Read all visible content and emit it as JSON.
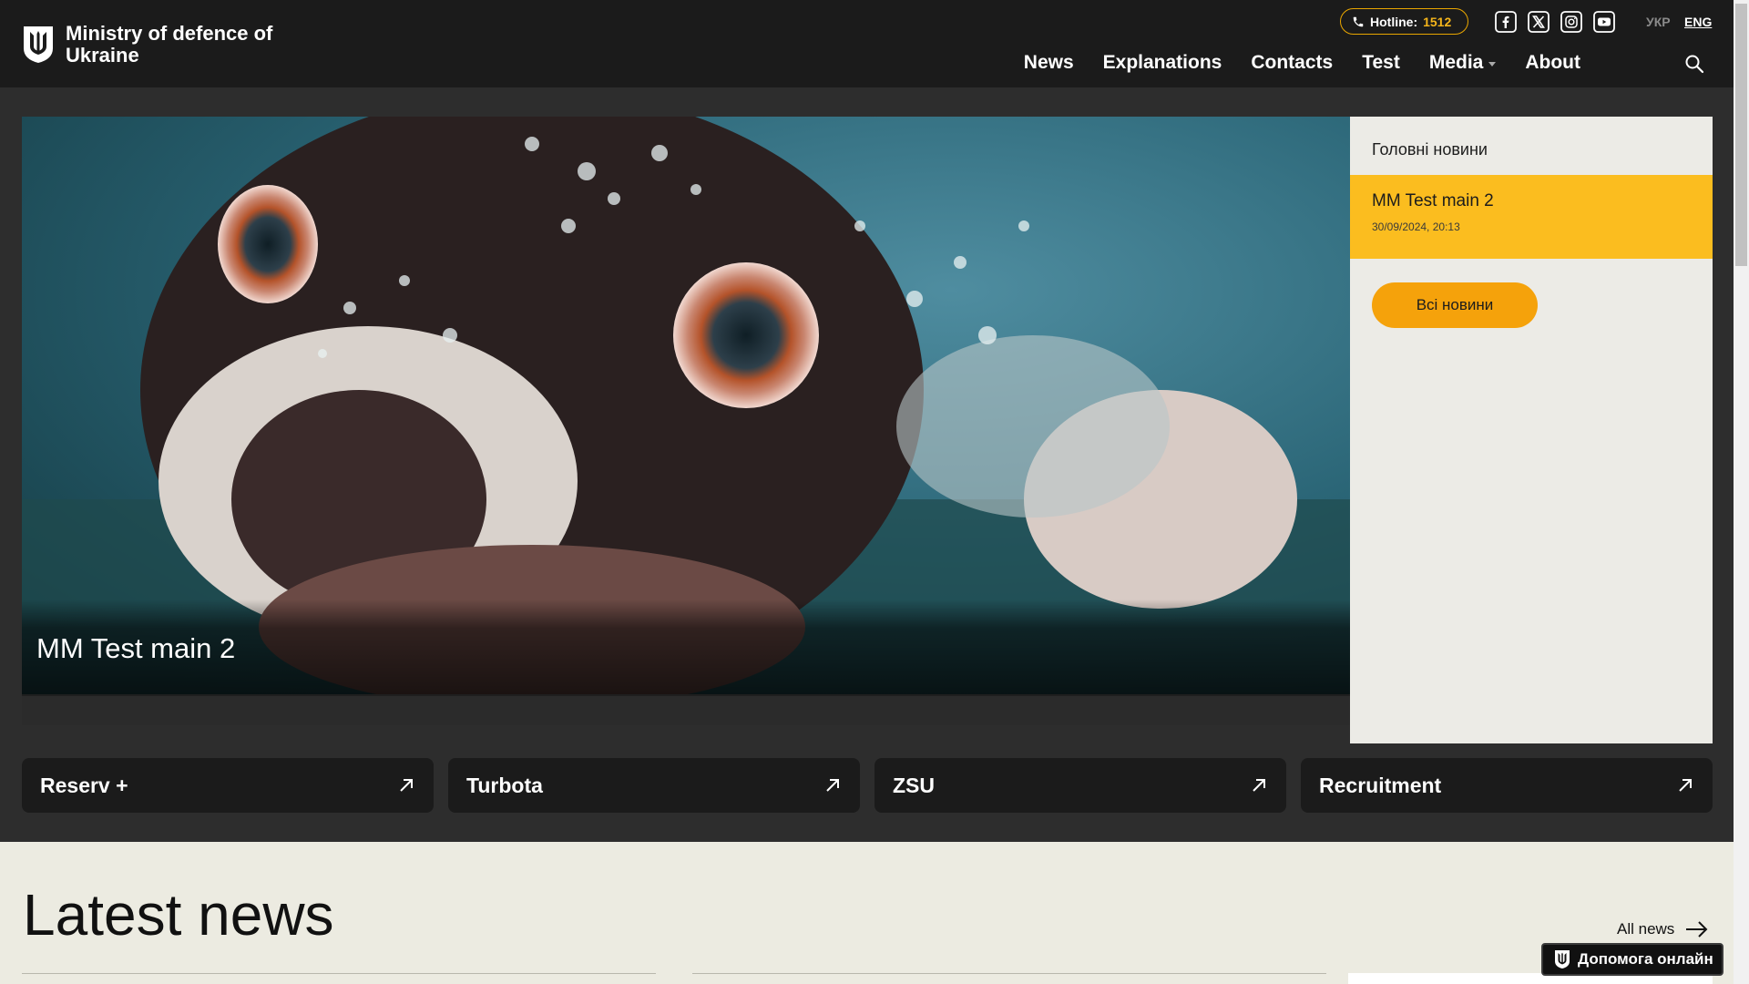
{
  "header": {
    "logo_text": "Ministry of defence of Ukraine",
    "hotline_label": "Hotline:",
    "hotline_number": "1512",
    "socials": [
      "facebook-icon",
      "x-icon",
      "instagram-icon",
      "youtube-icon"
    ],
    "lang_ua": "УКР",
    "lang_en": "ENG",
    "nav": [
      "News",
      "Explanations",
      "Contacts",
      "Test",
      "Media",
      "About"
    ]
  },
  "hero": {
    "title": "MM Test main 2"
  },
  "side": {
    "heading": "Головні новини",
    "active_title": "MM Test main 2",
    "active_date": "30/09/2024, 20:13",
    "button": "Всі новини"
  },
  "quick_links": [
    "Reserv +",
    "Turbota",
    "ZSU",
    "Recruitment"
  ],
  "latest": {
    "title": "Latest news",
    "all_news": "All news"
  },
  "help": {
    "label": "Допомога онлайн"
  },
  "colors": {
    "accent_yellow": "#fbbd1f",
    "accent_orange": "#f5a20b",
    "header_bg": "#1b1b1b",
    "light_bg": "#ecebe1"
  }
}
